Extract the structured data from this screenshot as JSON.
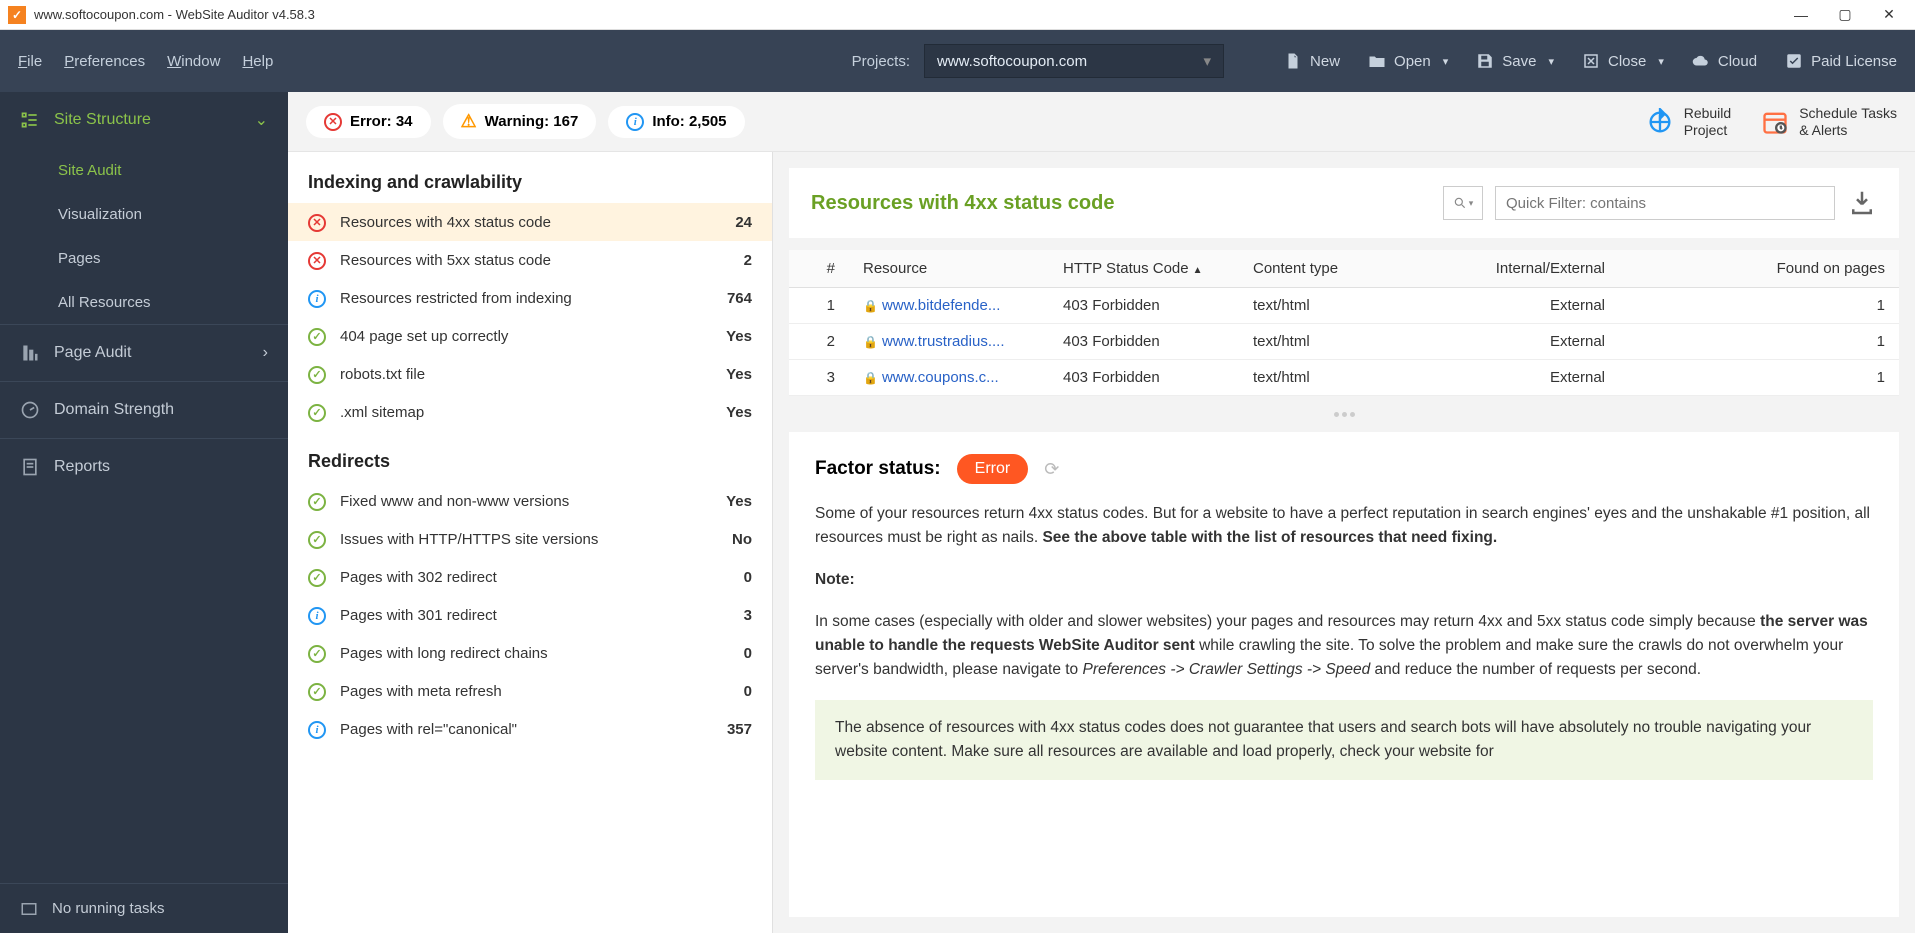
{
  "titlebar": {
    "title": "www.softocoupon.com - WebSite Auditor v4.58.3"
  },
  "menu": {
    "file": "File",
    "preferences": "Preferences",
    "window": "Window",
    "help": "Help"
  },
  "projects": {
    "label": "Projects:",
    "selected": "www.softocoupon.com"
  },
  "toolbar": {
    "new": "New",
    "open": "Open",
    "save": "Save",
    "close": "Close",
    "cloud": "Cloud",
    "paid_license": "Paid License"
  },
  "summary": {
    "error_label": "Error: ",
    "error_count": "34",
    "warning_label": "Warning: ",
    "warning_count": "167",
    "info_label": "Info: ",
    "info_count": "2,505"
  },
  "actions": {
    "rebuild_l1": "Rebuild",
    "rebuild_l2": "Project",
    "schedule_l1": "Schedule Tasks",
    "schedule_l2": "& Alerts"
  },
  "sidebar": {
    "site_structure": "Site Structure",
    "site_audit": "Site Audit",
    "visualization": "Visualization",
    "pages": "Pages",
    "all_resources": "All Resources",
    "page_audit": "Page Audit",
    "domain_strength": "Domain Strength",
    "reports": "Reports",
    "footer": "No running tasks"
  },
  "audit": {
    "group1_title": "Indexing and crawlability",
    "group1": [
      {
        "label": "Resources with 4xx status code",
        "value": "24",
        "status": "error",
        "selected": true
      },
      {
        "label": "Resources with 5xx status code",
        "value": "2",
        "status": "error"
      },
      {
        "label": "Resources restricted from indexing",
        "value": "764",
        "status": "info"
      },
      {
        "label": "404 page set up correctly",
        "value": "Yes",
        "status": "ok"
      },
      {
        "label": "robots.txt file",
        "value": "Yes",
        "status": "ok"
      },
      {
        "label": ".xml sitemap",
        "value": "Yes",
        "status": "ok"
      }
    ],
    "group2_title": "Redirects",
    "group2": [
      {
        "label": "Fixed www and non-www versions",
        "value": "Yes",
        "status": "ok"
      },
      {
        "label": "Issues with HTTP/HTTPS site versions",
        "value": "No",
        "status": "ok"
      },
      {
        "label": "Pages with 302 redirect",
        "value": "0",
        "status": "ok"
      },
      {
        "label": "Pages with 301 redirect",
        "value": "3",
        "status": "info"
      },
      {
        "label": "Pages with long redirect chains",
        "value": "0",
        "status": "ok"
      },
      {
        "label": "Pages with meta refresh",
        "value": "0",
        "status": "ok"
      },
      {
        "label": "Pages with rel=\"canonical\"",
        "value": "357",
        "status": "info"
      }
    ]
  },
  "detail": {
    "title": "Resources with 4xx status code",
    "filter_placeholder": "Quick Filter: contains",
    "columns": {
      "idx": "#",
      "resource": "Resource",
      "status": "HTTP Status Code",
      "ctype": "Content type",
      "intext": "Internal/External",
      "found": "Found on pages"
    },
    "rows": [
      {
        "idx": "1",
        "resource": "www.bitdefende...",
        "status": "403 Forbidden",
        "ctype": "text/html",
        "intext": "External",
        "found": "1"
      },
      {
        "idx": "2",
        "resource": "www.trustradius....",
        "status": "403 Forbidden",
        "ctype": "text/html",
        "intext": "External",
        "found": "1"
      },
      {
        "idx": "3",
        "resource": "www.coupons.c...",
        "status": "403 Forbidden",
        "ctype": "text/html",
        "intext": "External",
        "found": "1"
      }
    ]
  },
  "factor": {
    "status_label": "Factor status:",
    "badge": "Error",
    "p1_a": "Some of your resources return 4xx status codes. But for a website to have a perfect reputation in search engines' eyes and the unshakable #1 position, all resources must be right as nails. ",
    "p1_b": "See the above table with the list of resources that need fixing.",
    "note": "Note:",
    "p2_a": "In some cases (especially with older and slower websites) your pages and resources may return 4xx and 5xx status code simply because ",
    "p2_b": "the server was unable to handle the requests WebSite Auditor sent",
    "p2_c": " while crawling the site. To solve the problem and make sure the crawls do not overwhelm your server's bandwidth, please navigate to ",
    "p2_d": "Preferences -> Crawler Settings -> Speed",
    "p2_e": " and reduce the number of requests per second.",
    "highlight": "The absence of resources with 4xx status codes does not guarantee that users and search bots will have absolutely no trouble navigating your website content. Make sure all resources are available and load properly, check your website for"
  }
}
